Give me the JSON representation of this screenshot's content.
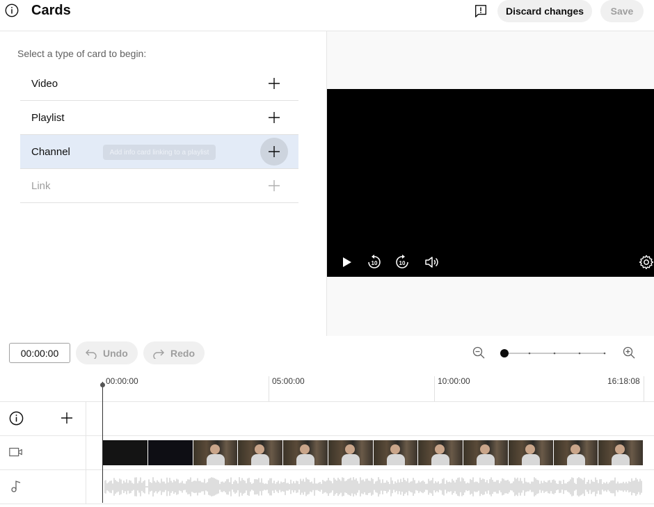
{
  "header": {
    "title": "Cards",
    "discard_label": "Discard changes",
    "save_label": "Save"
  },
  "panel": {
    "prompt": "Select a type of card to begin:",
    "cards": [
      {
        "label": "Video",
        "state": "normal"
      },
      {
        "label": "Playlist",
        "state": "normal"
      },
      {
        "label": "Channel",
        "state": "hover"
      },
      {
        "label": "Link",
        "state": "disabled"
      }
    ],
    "tooltip": "Add info card linking to a playlist"
  },
  "timeline": {
    "timecode": "00:00:00",
    "undo_label": "Undo",
    "redo_label": "Redo",
    "ticks": [
      "00:00:00",
      "05:00:00",
      "10:00:00",
      "16:18:08"
    ]
  },
  "colors": {
    "accent_hover": "#e3ebf7",
    "button_bg": "#f0f0f0",
    "video_bg": "#000000"
  }
}
